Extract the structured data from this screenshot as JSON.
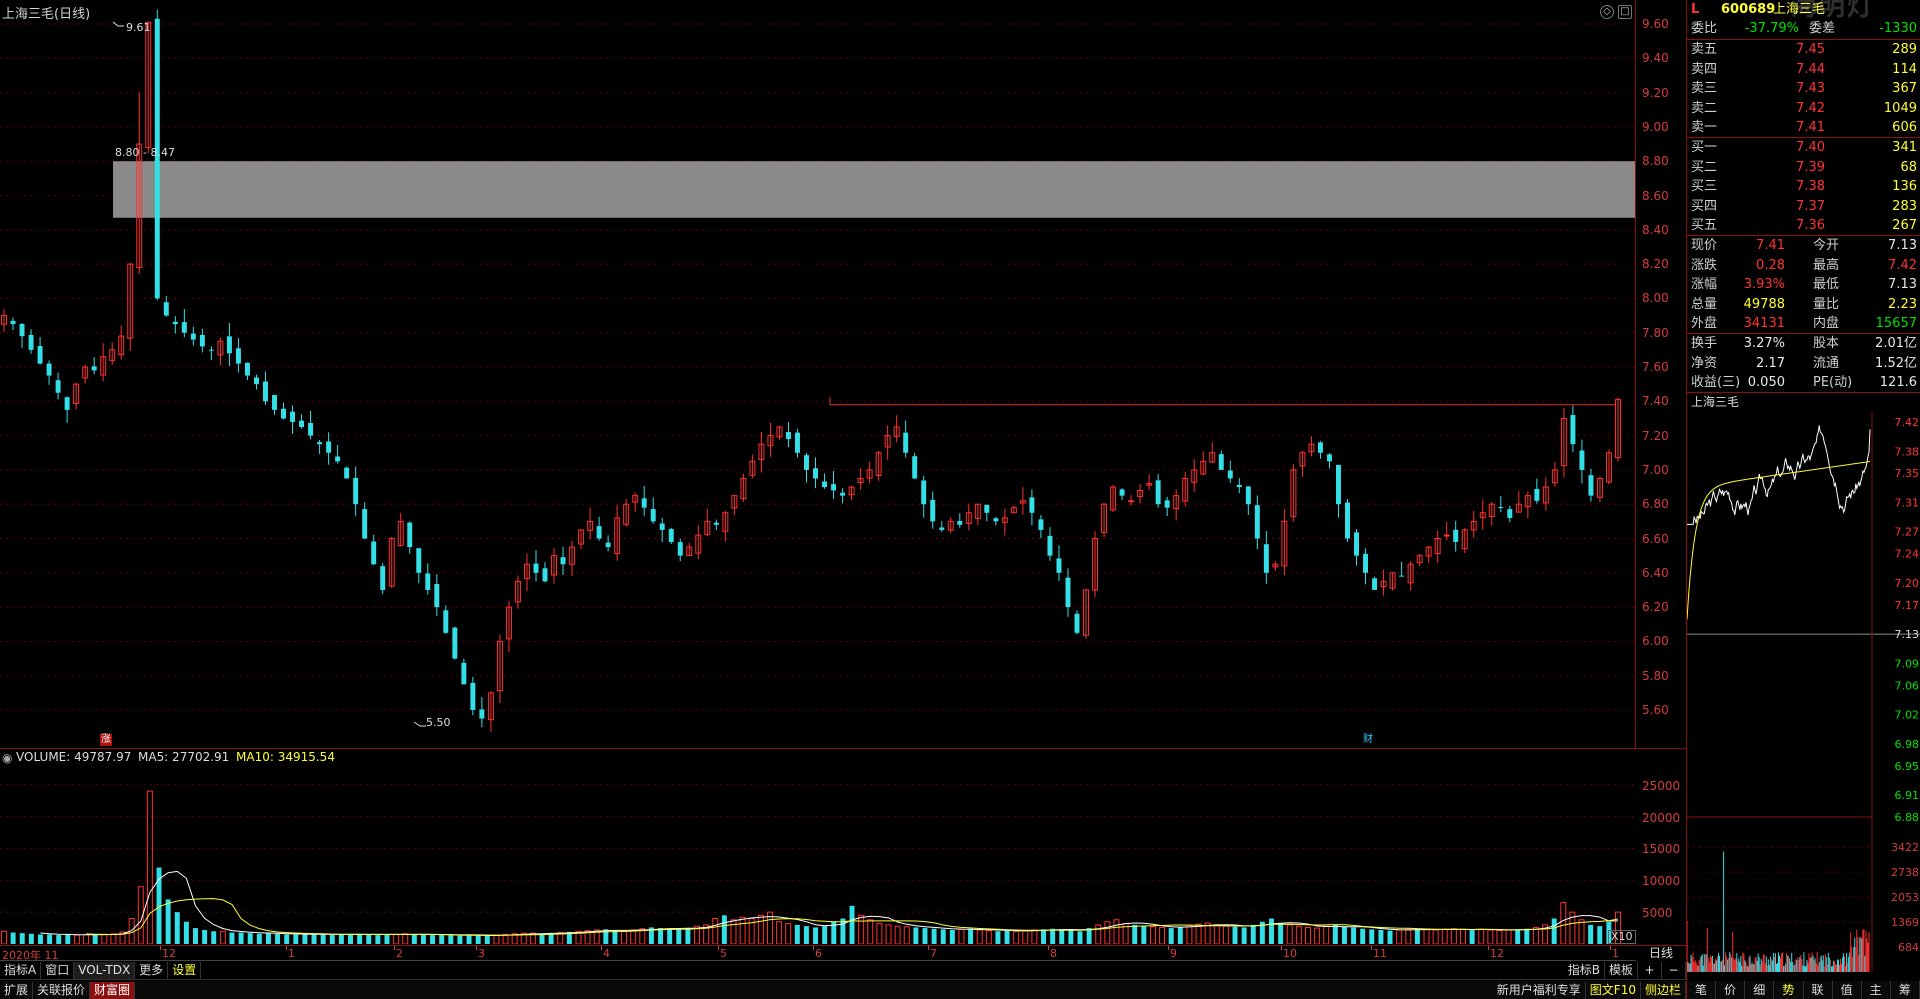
{
  "chart_title": "上海三毛(日线)",
  "price_axis": [
    "9.60",
    "9.40",
    "9.20",
    "9.00",
    "8.80",
    "8.60",
    "8.40",
    "8.20",
    "8.00",
    "7.80",
    "7.60",
    "7.40",
    "7.20",
    "7.00",
    "6.80",
    "6.60",
    "6.40",
    "6.20",
    "6.00",
    "5.80",
    "5.60"
  ],
  "annotations": {
    "high_label": "9.61",
    "low_label": "5.50",
    "zone_label": "8.80 - 8.47",
    "zhang_tag": "涨",
    "cai_tag": "财"
  },
  "volume_header": {
    "volume": "VOLUME: 49787.97",
    "ma5": "MA5: 27702.91",
    "ma10": "MA10: 34915.54",
    "multiplier": "X10"
  },
  "volume_axis": [
    "25000",
    "20000",
    "15000",
    "10000",
    "5000"
  ],
  "date_axis": [
    "2020年 11",
    "12",
    "1",
    "2",
    "3",
    "4",
    "5",
    "6",
    "7",
    "8",
    "9",
    "10",
    "11",
    "12",
    "1"
  ],
  "daily_button": "日线",
  "toolbar1": [
    "指标A",
    "窗口",
    "VOL-TDX",
    "更多",
    "设置"
  ],
  "toolbar1_right": [
    "指标B",
    "模板",
    "+",
    "−"
  ],
  "toolbar2": [
    "扩展",
    "关联报价",
    "财富圈"
  ],
  "toolbar2_right": [
    "新用户福利专享",
    "图文F10",
    "侧边栏"
  ],
  "quote": {
    "code": "600689",
    "name": "上海三毛",
    "flag": "L",
    "wei_bi": {
      "label": "委比",
      "value": "-37.79%",
      "label2": "委差",
      "value2": "-1330"
    },
    "asks": [
      {
        "label": "卖五",
        "price": "7.45",
        "vol": "289"
      },
      {
        "label": "卖四",
        "price": "7.44",
        "vol": "114"
      },
      {
        "label": "卖三",
        "price": "7.43",
        "vol": "367"
      },
      {
        "label": "卖二",
        "price": "7.42",
        "vol": "1049"
      },
      {
        "label": "卖一",
        "price": "7.41",
        "vol": "606"
      }
    ],
    "bids": [
      {
        "label": "买一",
        "price": "7.40",
        "vol": "341"
      },
      {
        "label": "买二",
        "price": "7.39",
        "vol": "68"
      },
      {
        "label": "买三",
        "price": "7.38",
        "vol": "136"
      },
      {
        "label": "买四",
        "price": "7.37",
        "vol": "283"
      },
      {
        "label": "买五",
        "price": "7.36",
        "vol": "267"
      }
    ],
    "stats": [
      {
        "l1": "现价",
        "v1": "7.41",
        "c1": "red",
        "l2": "今开",
        "v2": "7.13",
        "c2": "white"
      },
      {
        "l1": "涨跌",
        "v1": "0.28",
        "c1": "red",
        "l2": "最高",
        "v2": "7.42",
        "c2": "red"
      },
      {
        "l1": "涨幅",
        "v1": "3.93%",
        "c1": "red",
        "l2": "最低",
        "v2": "7.13",
        "c2": "white"
      },
      {
        "l1": "总量",
        "v1": "49788",
        "c1": "yellow",
        "l2": "量比",
        "v2": "2.23",
        "c2": "yellow"
      },
      {
        "l1": "外盘",
        "v1": "34131",
        "c1": "red",
        "l2": "内盘",
        "v2": "15657",
        "c2": "green"
      }
    ],
    "stats2": [
      {
        "l1": "换手",
        "v1": "3.27%",
        "l2": "股本",
        "v2": "2.01亿"
      },
      {
        "l1": "净资",
        "v1": "2.17",
        "l2": "流通",
        "v2": "1.52亿"
      },
      {
        "l1": "收益(三)",
        "v1": "0.050",
        "l2": "PE(动)",
        "v2": "121.6"
      }
    ]
  },
  "mini_chart": {
    "title": "上海三毛",
    "price_axis": [
      "7.42",
      "7.38",
      "7.35",
      "7.31",
      "7.27",
      "7.24",
      "7.20",
      "7.17",
      "7.13",
      "7.09",
      "7.06",
      "7.02",
      "6.98",
      "6.95",
      "6.91",
      "6.88"
    ],
    "vol_axis": [
      "3422",
      "2738",
      "2053",
      "1369",
      "684"
    ]
  },
  "bottom_tabs": [
    "笔",
    "价",
    "细",
    "势",
    "联",
    "值",
    "主",
    "筹"
  ],
  "active_tab": "势",
  "chart_data": {
    "type": "candlestick",
    "title": "上海三毛(日线)",
    "ylim": [
      5.4,
      9.7
    ],
    "x_months": [
      "2020年 11",
      "12",
      "1",
      "2",
      "3",
      "4",
      "5",
      "6",
      "7",
      "8",
      "9",
      "10",
      "11",
      "12",
      "1"
    ],
    "resistance_zone": [
      8.47,
      8.8
    ],
    "resistance_line": 7.38,
    "high": 9.61,
    "low": 5.5,
    "close_path": [
      7.9,
      7.85,
      7.78,
      7.7,
      7.62,
      7.55,
      7.45,
      7.35,
      7.5,
      7.6,
      7.58,
      7.66,
      7.7,
      7.78,
      8.2,
      8.9,
      9.61,
      8.0,
      7.9,
      7.85,
      7.8,
      7.76,
      7.72,
      7.7,
      7.75,
      7.68,
      7.62,
      7.55,
      7.5,
      7.4,
      7.35,
      7.3,
      7.28,
      7.25,
      7.2,
      7.15,
      7.1,
      7.05,
      6.95,
      6.8,
      6.6,
      6.45,
      6.3,
      6.6,
      6.7,
      6.55,
      6.4,
      6.3,
      6.2,
      6.05,
      5.9,
      5.75,
      5.6,
      5.55,
      5.7,
      6.0,
      6.2,
      6.35,
      6.45,
      6.4,
      6.35,
      6.5,
      6.45,
      6.55,
      6.65,
      6.7,
      6.6,
      6.55,
      6.72,
      6.8,
      6.85,
      6.78,
      6.7,
      6.65,
      6.58,
      6.5,
      6.55,
      6.62,
      6.7,
      6.68,
      6.75,
      6.85,
      6.95,
      7.05,
      7.15,
      7.2,
      7.25,
      7.18,
      7.1,
      7.0,
      6.95,
      6.9,
      6.88,
      6.85,
      6.9,
      6.95,
      7.0,
      7.1,
      7.2,
      7.25,
      7.1,
      6.95,
      6.8,
      6.7,
      6.65,
      6.7,
      6.68,
      6.75,
      6.8,
      6.75,
      6.7,
      6.72,
      6.78,
      6.82,
      6.75,
      6.65,
      6.5,
      6.4,
      6.2,
      6.05,
      6.3,
      6.6,
      6.8,
      6.9,
      6.85,
      6.82,
      6.88,
      6.92,
      6.8,
      6.78,
      6.85,
      6.95,
      7.0,
      7.05,
      7.1,
      7.0,
      6.95,
      6.9,
      6.8,
      6.6,
      6.4,
      6.45,
      6.7,
      7.0,
      7.1,
      7.15,
      7.1,
      7.05,
      6.8,
      6.6,
      6.5,
      6.4,
      6.3,
      6.35,
      6.4,
      6.38,
      6.45,
      6.5,
      6.55,
      6.6,
      6.62,
      6.58,
      6.65,
      6.7,
      6.75,
      6.8,
      6.78,
      6.72,
      6.8,
      6.85,
      6.82,
      6.9,
      7.0,
      7.3,
      7.15,
      7.0,
      6.85,
      6.95,
      7.1,
      7.41
    ],
    "volume_path": [
      2000,
      1800,
      1700,
      1600,
      1500,
      1500,
      1400,
      1500,
      1400,
      1450,
      1500,
      1500,
      1600,
      1900,
      4000,
      9000,
      24000,
      12000,
      7000,
      5000,
      3500,
      2500,
      2200,
      2000,
      2000,
      1800,
      1800,
      1700,
      1600,
      1700,
      1600,
      1500,
      1500,
      1500,
      1600,
      1500,
      1400,
      1500,
      1500,
      1600,
      1500,
      1400,
      1500,
      1500,
      1600,
      1500,
      1500,
      1400,
      1400,
      1400,
      1300,
      1300,
      1400,
      1300,
      1400,
      1500,
      1600,
      1700,
      1700,
      1600,
      1700,
      1800,
      1900,
      2000,
      2100,
      2200,
      2300,
      2100,
      2000,
      2200,
      2400,
      2600,
      2500,
      2400,
      2300,
      2500,
      2800,
      3000,
      4000,
      4500,
      3800,
      4200,
      4000,
      4500,
      5000,
      3500,
      3200,
      3000,
      2800,
      2600,
      2800,
      3500,
      4000,
      6000,
      4500,
      3800,
      3200,
      3000,
      2800,
      2700,
      2600,
      2500,
      2400,
      2300,
      2200,
      2300,
      2400,
      2200,
      2100,
      2000,
      2100,
      2000,
      2100,
      2200,
      2300,
      2400,
      2300,
      2200,
      2000,
      2500,
      3000,
      3500,
      3800,
      3200,
      3000,
      2800,
      2700,
      2600,
      2500,
      2700,
      2900,
      3100,
      3300,
      3000,
      2800,
      2700,
      2600,
      3000,
      3500,
      4000,
      3200,
      3000,
      2800,
      2600,
      2500,
      2800,
      3000,
      2700,
      2600,
      2400,
      2300,
      2200,
      2100,
      2200,
      2300,
      2400,
      2300,
      2200,
      2300,
      2400,
      2300,
      2200,
      2300,
      2200,
      2100,
      2200,
      2300,
      2400,
      2600,
      3000,
      4000,
      6500,
      5000,
      3800,
      3000,
      2800,
      3500,
      5000
    ]
  }
}
